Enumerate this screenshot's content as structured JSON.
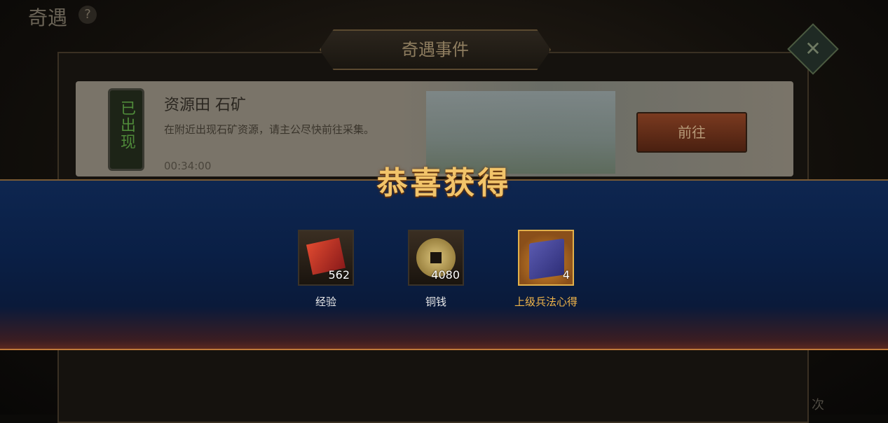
{
  "header": {
    "title": "奇遇",
    "help_icon": "?"
  },
  "panel": {
    "title": "奇遇事件"
  },
  "event": {
    "badge": "已出现",
    "title": "资源田 石矿",
    "description": "在附近出现石矿资源，请主公尽快前往采集。",
    "time": "00:34:00",
    "button": "前往"
  },
  "side_text": "次",
  "reward": {
    "title": "恭喜获得",
    "items": [
      {
        "icon": "exp-scroll-icon",
        "qty": "562",
        "label": "经验"
      },
      {
        "icon": "copper-coin-icon",
        "qty": "4080",
        "label": "铜钱"
      },
      {
        "icon": "strategy-book-icon",
        "qty": "4",
        "label": "上级兵法心得"
      }
    ]
  },
  "colors": {
    "reward_title": "#f2c46a",
    "rare_label": "#f2b64a",
    "band": "#0e2650"
  }
}
